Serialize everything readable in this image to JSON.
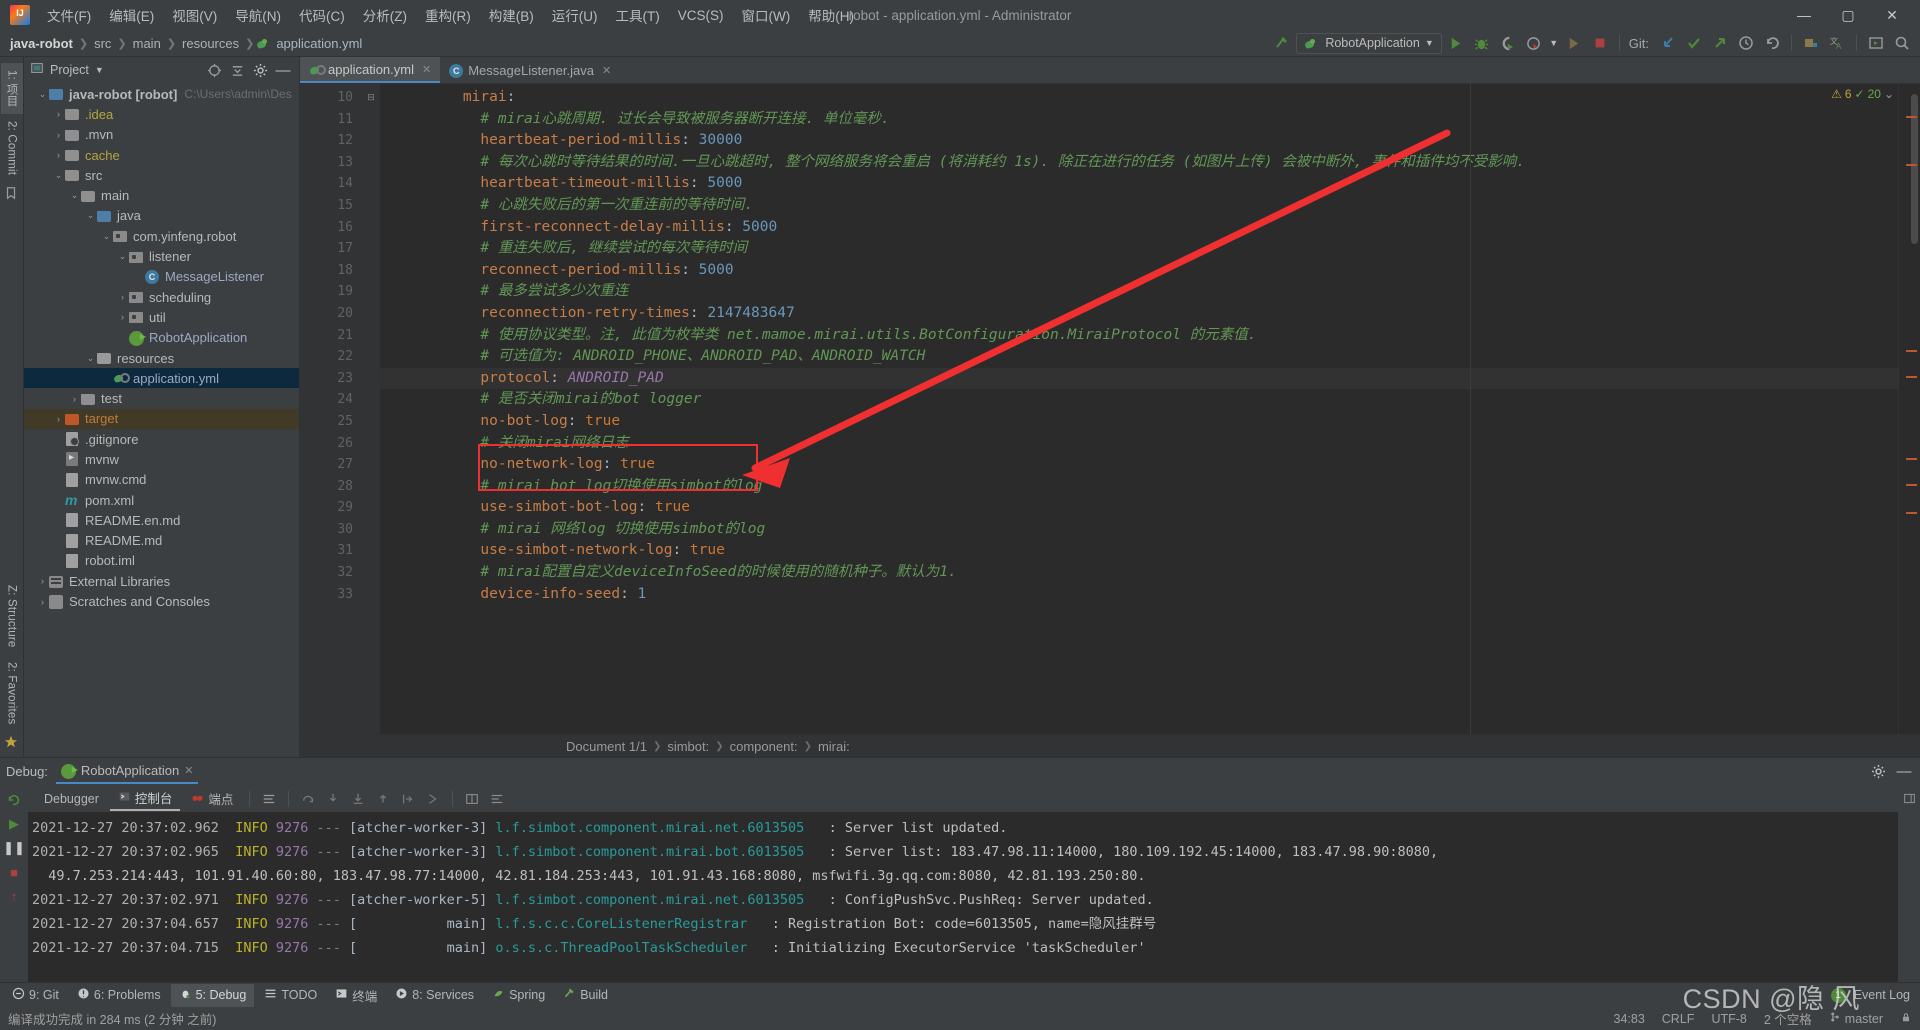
{
  "window": {
    "title": "robot - application.yml - Administrator",
    "minimize": "—",
    "maximize": "▢",
    "close": "✕"
  },
  "menu": [
    {
      "label": "文件(F)"
    },
    {
      "label": "编辑(E)"
    },
    {
      "label": "视图(V)"
    },
    {
      "label": "导航(N)"
    },
    {
      "label": "代码(C)"
    },
    {
      "label": "分析(Z)"
    },
    {
      "label": "重构(R)"
    },
    {
      "label": "构建(B)"
    },
    {
      "label": "运行(U)"
    },
    {
      "label": "工具(T)"
    },
    {
      "label": "VCS(S)"
    },
    {
      "label": "窗口(W)"
    },
    {
      "label": "帮助(H)"
    }
  ],
  "navbar": {
    "crumbs": [
      "java-robot",
      "src",
      "main",
      "resources",
      "application.yml"
    ],
    "run_config": "RobotApplication",
    "git_label": "Git:",
    "icons": [
      "run-icon",
      "debug-icon",
      "run-coverage-icon",
      "profiler-icon",
      "rerun-icon",
      "stop-icon",
      "git-update-icon",
      "git-commit-icon",
      "git-push-icon",
      "git-history-icon",
      "git-rollback-icon",
      "project-structure-icon",
      "translate-icon",
      "present-icon",
      "search-icon"
    ]
  },
  "left_strip": {
    "tabs": [
      "1: 项目",
      "2: Commit"
    ],
    "bottom_tabs": [
      "Z: Structure",
      "2: Favorites"
    ]
  },
  "project_panel": {
    "title": "Project",
    "root": "java-robot [robot]",
    "root_path": "C:\\Users\\admin\\Des",
    "tree": [
      {
        "label": ".idea",
        "indent": 1,
        "arrow": "›",
        "icon": "folder-icon",
        "style": "yellowf"
      },
      {
        "label": ".mvn",
        "indent": 1,
        "arrow": "›",
        "icon": "folder-icon",
        "style": ""
      },
      {
        "label": "cache",
        "indent": 1,
        "arrow": "›",
        "icon": "folder-icon",
        "style": "yellowf"
      },
      {
        "label": "src",
        "indent": 1,
        "arrow": "⌄",
        "icon": "folder-icon",
        "style": ""
      },
      {
        "label": "main",
        "indent": 2,
        "arrow": "⌄",
        "icon": "folder-icon",
        "style": ""
      },
      {
        "label": "java",
        "indent": 3,
        "arrow": "⌄",
        "icon": "source-folder-icon",
        "style": ""
      },
      {
        "label": "com.yinfeng.robot",
        "indent": 4,
        "arrow": "⌄",
        "icon": "package-icon",
        "style": ""
      },
      {
        "label": "listener",
        "indent": 5,
        "arrow": "⌄",
        "icon": "package-icon",
        "style": ""
      },
      {
        "label": "MessageListener",
        "indent": 6,
        "arrow": "",
        "icon": "java-class-icon",
        "style": "blue"
      },
      {
        "label": "scheduling",
        "indent": 5,
        "arrow": "›",
        "icon": "package-icon",
        "style": ""
      },
      {
        "label": "util",
        "indent": 5,
        "arrow": "›",
        "icon": "package-icon",
        "style": ""
      },
      {
        "label": "RobotApplication",
        "indent": 5,
        "arrow": "",
        "icon": "spring-boot-icon",
        "style": "blue"
      },
      {
        "label": "resources",
        "indent": 3,
        "arrow": "⌄",
        "icon": "resource-folder-icon",
        "style": ""
      },
      {
        "label": "application.yml",
        "indent": 4,
        "arrow": "",
        "icon": "yaml-file-icon",
        "style": "blue",
        "selected": true
      },
      {
        "label": "test",
        "indent": 2,
        "arrow": "›",
        "icon": "folder-icon",
        "style": ""
      },
      {
        "label": "target",
        "indent": 1,
        "arrow": "›",
        "icon": "target-folder-icon",
        "style": "orange",
        "highlight": true
      },
      {
        "label": ".gitignore",
        "indent": 1,
        "arrow": "",
        "icon": "gitignore-file-icon",
        "style": ""
      },
      {
        "label": "mvnw",
        "indent": 1,
        "arrow": "",
        "icon": "script-file-icon",
        "style": ""
      },
      {
        "label": "mvnw.cmd",
        "indent": 1,
        "arrow": "",
        "icon": "file-icon",
        "style": ""
      },
      {
        "label": "pom.xml",
        "indent": 1,
        "arrow": "",
        "icon": "maven-file-icon",
        "style": ""
      },
      {
        "label": "README.en.md",
        "indent": 1,
        "arrow": "",
        "icon": "file-icon",
        "style": ""
      },
      {
        "label": "README.md",
        "indent": 1,
        "arrow": "",
        "icon": "file-icon",
        "style": ""
      },
      {
        "label": "robot.iml",
        "indent": 1,
        "arrow": "",
        "icon": "file-icon",
        "style": ""
      },
      {
        "label": "External Libraries",
        "indent": 0,
        "arrow": "›",
        "icon": "library-icon",
        "style": ""
      },
      {
        "label": "Scratches and Consoles",
        "indent": 0,
        "arrow": "›",
        "icon": "scratch-icon",
        "style": ""
      }
    ]
  },
  "editor": {
    "tabs": [
      {
        "label": "application.yml",
        "icon": "yaml-file-icon",
        "active": true,
        "close": "✕"
      },
      {
        "label": "MessageListener.java",
        "icon": "java-class-icon",
        "active": false,
        "close": "✕"
      }
    ],
    "inspections": {
      "warnings": "6",
      "weak_warnings": "20",
      "warn_icon": "warning-triangle-icon",
      "ok_icon": "checkmark-icon",
      "chevron": "⌄"
    },
    "first_line_number": 10,
    "lines": [
      {
        "n": 10,
        "fold": "⊟",
        "tokens": [
          {
            "t": "mirai",
            "c": "k"
          },
          {
            "t": ":",
            "c": "p"
          }
        ],
        "indent": 2
      },
      {
        "n": 11,
        "tokens": [
          {
            "t": "# mirai心跳周期. 过长会导致被服务器断开连接. 单位毫秒.",
            "c": "c"
          }
        ],
        "indent": 3
      },
      {
        "n": 12,
        "tokens": [
          {
            "t": "heartbeat-period-millis",
            "c": "k"
          },
          {
            "t": ": ",
            "c": "p"
          },
          {
            "t": "30000",
            "c": "n"
          }
        ],
        "indent": 3
      },
      {
        "n": 13,
        "tokens": [
          {
            "t": "# 每次心跳时等待结果的时间.一旦心跳超时, 整个网络服务将会重启 (将消耗约 1s). 除正在进行的任务 (如图片上传) 会被中断外, 事件和插件均不受影响.",
            "c": "c"
          }
        ],
        "indent": 3
      },
      {
        "n": 14,
        "tokens": [
          {
            "t": "heartbeat-timeout-millis",
            "c": "k"
          },
          {
            "t": ": ",
            "c": "p"
          },
          {
            "t": "5000",
            "c": "n"
          }
        ],
        "indent": 3
      },
      {
        "n": 15,
        "tokens": [
          {
            "t": "# 心跳失败后的第一次重连前的等待时间.",
            "c": "c"
          }
        ],
        "indent": 3
      },
      {
        "n": 16,
        "tokens": [
          {
            "t": "first-reconnect-delay-millis",
            "c": "k"
          },
          {
            "t": ": ",
            "c": "p"
          },
          {
            "t": "5000",
            "c": "n"
          }
        ],
        "indent": 3
      },
      {
        "n": 17,
        "tokens": [
          {
            "t": "# 重连失败后, 继续尝试的每次等待时间",
            "c": "c"
          }
        ],
        "indent": 3
      },
      {
        "n": 18,
        "tokens": [
          {
            "t": "reconnect-period-millis",
            "c": "k"
          },
          {
            "t": ": ",
            "c": "p"
          },
          {
            "t": "5000",
            "c": "n"
          }
        ],
        "indent": 3
      },
      {
        "n": 19,
        "tokens": [
          {
            "t": "# 最多尝试多少次重连",
            "c": "c"
          }
        ],
        "indent": 3
      },
      {
        "n": 20,
        "tokens": [
          {
            "t": "reconnection-retry-times",
            "c": "k"
          },
          {
            "t": ": ",
            "c": "p"
          },
          {
            "t": "2147483647",
            "c": "n"
          }
        ],
        "indent": 3
      },
      {
        "n": 21,
        "tokens": [
          {
            "t": "# 使用协议类型。注, 此值为枚举类 net.mamoe.mirai.utils.BotConfiguration.MiraiProtocol 的元素值.",
            "c": "c"
          }
        ],
        "indent": 3
      },
      {
        "n": 22,
        "tokens": [
          {
            "t": "# 可选值为: ANDROID_PHONE、ANDROID_PAD、ANDROID_WATCH",
            "c": "c"
          }
        ],
        "indent": 3
      },
      {
        "n": 23,
        "current": true,
        "tokens": [
          {
            "t": "protocol",
            "c": "k"
          },
          {
            "t": ": ",
            "c": "p"
          },
          {
            "t": "ANDROID_PAD",
            "c": "v"
          }
        ],
        "indent": 3
      },
      {
        "n": 24,
        "tokens": [
          {
            "t": "# 是否关闭mirai的bot logger",
            "c": "c"
          }
        ],
        "indent": 3
      },
      {
        "n": 25,
        "tokens": [
          {
            "t": "no-bot-log",
            "c": "k"
          },
          {
            "t": ": ",
            "c": "p"
          },
          {
            "t": "true",
            "c": "b"
          }
        ],
        "indent": 3
      },
      {
        "n": 26,
        "tokens": [
          {
            "t": "# 关闭mirai网络日志",
            "c": "c"
          }
        ],
        "indent": 3
      },
      {
        "n": 27,
        "tokens": [
          {
            "t": "no-network-log",
            "c": "k"
          },
          {
            "t": ": ",
            "c": "p"
          },
          {
            "t": "true",
            "c": "b"
          }
        ],
        "indent": 3
      },
      {
        "n": 28,
        "tokens": [
          {
            "t": "# mirai bot log切换使用simbot的log",
            "c": "c"
          }
        ],
        "indent": 3
      },
      {
        "n": 29,
        "tokens": [
          {
            "t": "use-simbot-bot-log",
            "c": "k"
          },
          {
            "t": ": ",
            "c": "p"
          },
          {
            "t": "true",
            "c": "b"
          }
        ],
        "indent": 3
      },
      {
        "n": 30,
        "tokens": [
          {
            "t": "# mirai 网络log 切换使用simbot的log",
            "c": "c"
          }
        ],
        "indent": 3
      },
      {
        "n": 31,
        "tokens": [
          {
            "t": "use-simbot-network-log",
            "c": "k"
          },
          {
            "t": ": ",
            "c": "p"
          },
          {
            "t": "true",
            "c": "b"
          }
        ],
        "indent": 3
      },
      {
        "n": 32,
        "tokens": [
          {
            "t": "# mirai配置自定义deviceInfoSeed的时候使用的随机种子。默认为1.",
            "c": "c"
          }
        ],
        "indent": 3
      },
      {
        "n": 33,
        "tokens": [
          {
            "t": "device-info-seed",
            "c": "k"
          },
          {
            "t": ": ",
            "c": "p"
          },
          {
            "t": "1",
            "c": "n"
          }
        ],
        "indent": 3
      }
    ],
    "breadcrumb": [
      "Document 1/1",
      "simbot:",
      "component:",
      "mirai:"
    ]
  },
  "debug": {
    "label": "Debug:",
    "config": "RobotApplication",
    "close": "✕",
    "tabs": [
      {
        "label": "Debugger",
        "icon": "debugger-icon",
        "active": false
      },
      {
        "label": "控制台",
        "icon": "console-icon",
        "active": true
      },
      {
        "label": "端点",
        "icon": "breakpoints-icon",
        "active": false
      }
    ],
    "toolbar_icons": [
      "soft-wrap-icon",
      "restart-icon",
      "step-over-icon",
      "step-into-icon",
      "force-step-into-icon",
      "step-out-icon",
      "run-to-cursor-icon",
      "evaluate-icon",
      "layout-icon",
      "settings-icon"
    ],
    "side_icons": [
      "rerun-icon",
      "resume-icon",
      "pause-icon",
      "stop-icon",
      "mute-breakpoints-icon"
    ],
    "console_lines": [
      {
        "time": "2021-12-27 20:37:02.962",
        "level": "INFO",
        "pid": "9276",
        "dash": "---",
        "thread": "[atcher-worker-3]",
        "cls": "l.f.simbot.component.mirai.net.6013505",
        "msg": ": Server list updated."
      },
      {
        "time": "2021-12-27 20:37:02.965",
        "level": "INFO",
        "pid": "9276",
        "dash": "---",
        "thread": "[atcher-worker-3]",
        "cls": "l.f.simbot.component.mirai.bot.6013505",
        "msg": ": Server list: 183.47.98.11:14000, 180.109.192.45:14000, 183.47.98.90:8080,"
      },
      {
        "cont": "  49.7.253.214:443, 101.91.40.60:80, 183.47.98.77:14000, 42.81.184.253:443, 101.91.43.168:8080, msfwifi.3g.qq.com:8080, 42.81.193.250:80."
      },
      {
        "time": "2021-12-27 20:37:02.971",
        "level": "INFO",
        "pid": "9276",
        "dash": "---",
        "thread": "[atcher-worker-5]",
        "cls": "l.f.simbot.component.mirai.net.6013505",
        "msg": ": ConfigPushSvc.PushReq: Server updated."
      },
      {
        "time": "2021-12-27 20:37:04.657",
        "level": "INFO",
        "pid": "9276",
        "dash": "---",
        "thread": "[           main]",
        "cls": "l.f.s.c.c.CoreListenerRegistrar",
        "msg": ": Registration Bot: code=6013505, name=隐风挂群号"
      },
      {
        "time": "2021-12-27 20:37:04.715",
        "level": "INFO",
        "pid": "9276",
        "dash": "---",
        "thread": "[           main]",
        "cls": "o.s.s.c.ThreadPoolTaskScheduler",
        "msg": ": Initializing ExecutorService 'taskScheduler'"
      }
    ]
  },
  "bottom_bar": {
    "items": [
      {
        "label": "9: Git",
        "icon": "git-icon",
        "active": false
      },
      {
        "label": "6: Problems",
        "icon": "problems-icon",
        "active": false
      },
      {
        "label": "5: Debug",
        "icon": "debug-icon",
        "active": true
      },
      {
        "label": "TODO",
        "icon": "todo-icon",
        "active": false
      },
      {
        "label": "终端",
        "icon": "terminal-icon",
        "active": false
      },
      {
        "label": "8: Services",
        "icon": "services-icon",
        "active": false
      },
      {
        "label": "Spring",
        "icon": "spring-icon",
        "active": false
      },
      {
        "label": "Build",
        "icon": "build-icon",
        "active": false
      }
    ],
    "event_log": "Event Log",
    "event_count": "1"
  },
  "status_bar": {
    "message": "编译成功完成 in 284 ms (2 分钟 之前)",
    "caret": "34:83",
    "line_sep": "CRLF",
    "encoding": "UTF-8",
    "indent": "2 个空格",
    "branch": "master",
    "branch_icon": "git-branch-icon",
    "lock_icon": "lock-icon"
  },
  "watermark": {
    "text": "CSDN @隐 风",
    "sub": ""
  },
  "colors": {
    "accent": "#4a88c7",
    "annotation_red": "#f03030",
    "selection": "#0d293e",
    "editor_bg": "#2b2b2b",
    "panel_bg": "#3c3f41"
  }
}
